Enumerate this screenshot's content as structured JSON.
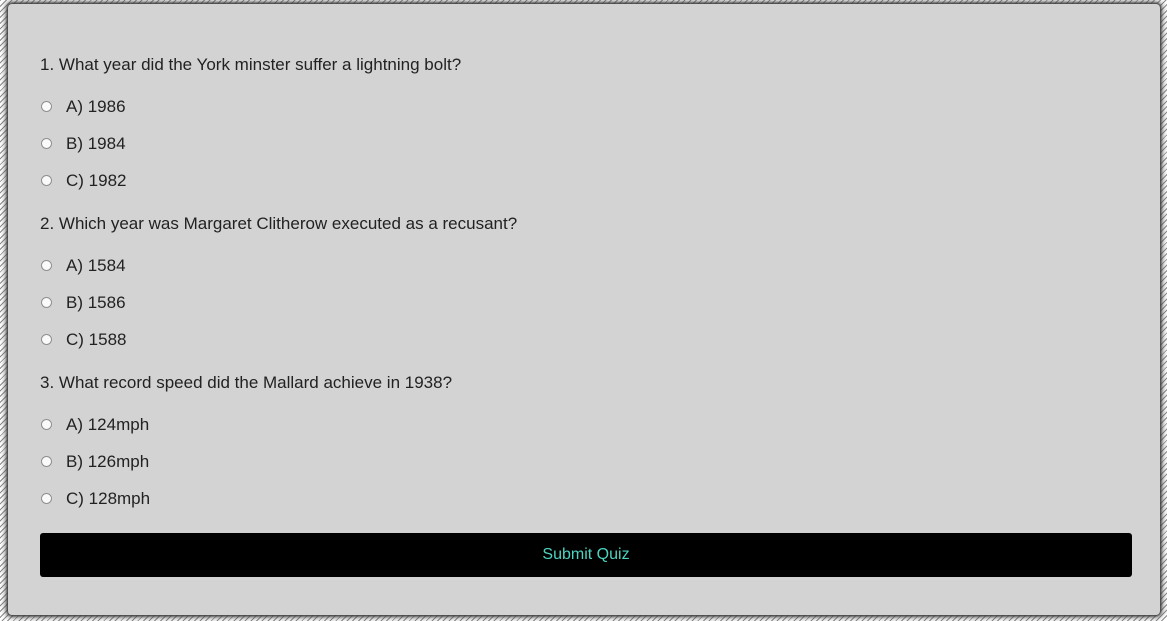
{
  "questions": [
    {
      "text": "1. What year did the York minster suffer a lightning bolt?",
      "options": [
        "A) 1986",
        "B) 1984",
        "C) 1982"
      ]
    },
    {
      "text": "2. Which year was Margaret Clitherow executed as a recusant?",
      "options": [
        "A) 1584",
        "B) 1586",
        "C) 1588"
      ]
    },
    {
      "text": "3. What record speed did the Mallard achieve in 1938?",
      "options": [
        "A) 124mph",
        "B) 126mph",
        "C) 128mph"
      ]
    }
  ],
  "submit_label": "Submit Quiz",
  "colors": {
    "panel_background": "#d3d3d3",
    "button_background": "#000000",
    "button_text": "#4cd4c0"
  }
}
